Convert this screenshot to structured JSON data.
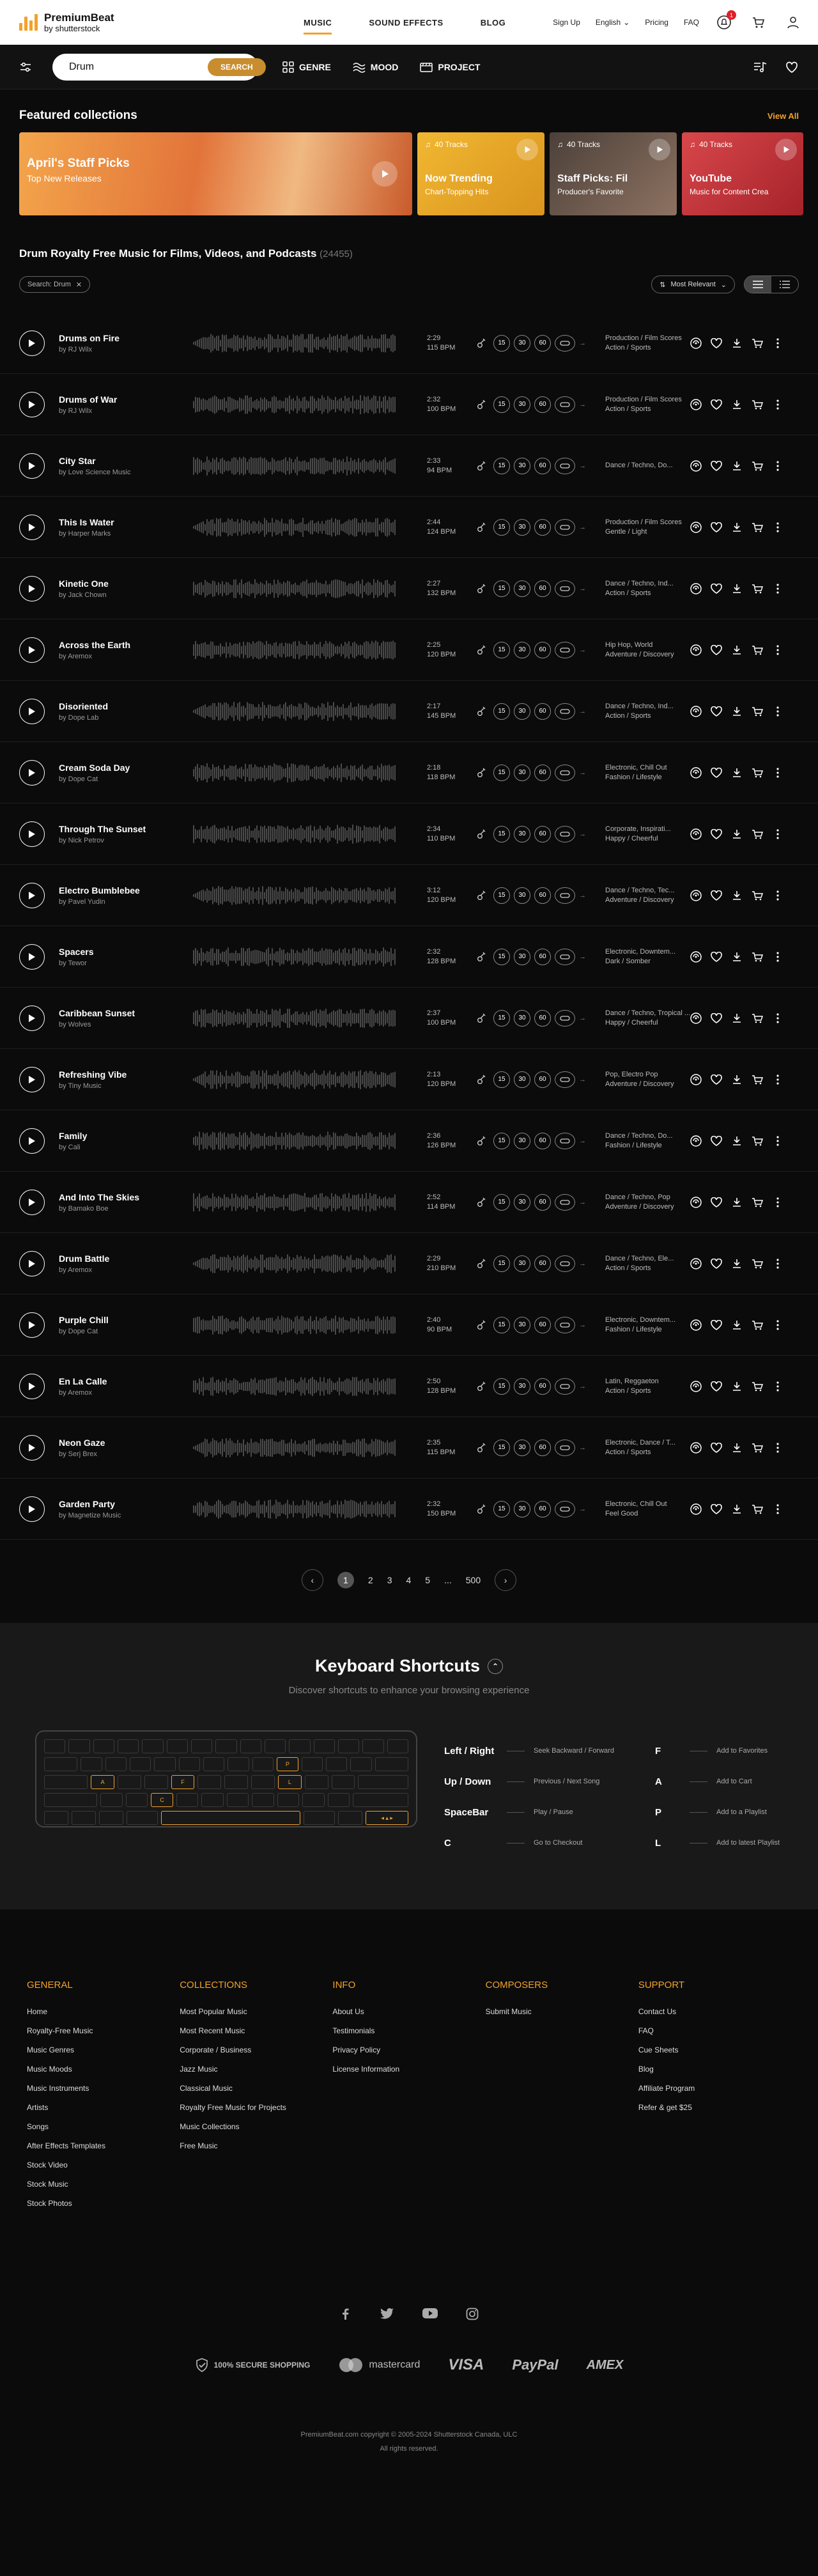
{
  "header": {
    "logo_line1": "PremiumBeat",
    "logo_line2": "by shutterstock",
    "nav": [
      "MUSIC",
      "SOUND EFFECTS",
      "BLOG"
    ],
    "signup": "Sign Up",
    "language": "English",
    "pricing": "Pricing",
    "faq": "FAQ",
    "notif_count": "1"
  },
  "filters": {
    "search_value": "Drum",
    "search_button": "SEARCH",
    "genre": "GENRE",
    "mood": "MOOD",
    "project": "PROJECT"
  },
  "featured": {
    "title": "Featured collections",
    "view_all": "View All",
    "cards": [
      {
        "title": "April's Staff Picks",
        "sub": "Top New Releases",
        "tracks": "",
        "color": "#e98a3a"
      },
      {
        "title": "Now Trending",
        "sub": "Chart-Topping Hits",
        "tracks": "40 Tracks",
        "color": "#e8a92c"
      },
      {
        "title": "Staff Picks: Fil",
        "sub": "Producer's Favorite",
        "tracks": "40 Tracks",
        "color": "#6b5a50"
      },
      {
        "title": "YouTube",
        "sub": "Music for Content Crea",
        "tracks": "40 Tracks",
        "color": "#c0363e"
      }
    ]
  },
  "results": {
    "heading": "Drum Royalty Free Music for Films, Videos, and Podcasts",
    "count": "(24455)",
    "chip": "Search: Drum",
    "sort": "Most Relevant"
  },
  "tracks": [
    {
      "title": "Drums on Fire",
      "artist": "by RJ Wilx",
      "dur": "2:29",
      "bpm": "115 BPM",
      "g1": "Production / Film Scores",
      "g2": "Action / Sports"
    },
    {
      "title": "Drums of War",
      "artist": "by RJ Wilx",
      "dur": "2:32",
      "bpm": "100 BPM",
      "g1": "Production / Film Scores",
      "g2": "Action / Sports"
    },
    {
      "title": "City Star",
      "artist": "by Love Science Music",
      "dur": "2:33",
      "bpm": "94 BPM",
      "g1": "Dance / Techno, Do...",
      "g2": ""
    },
    {
      "title": "This Is Water",
      "artist": "by Harper Marks",
      "dur": "2:44",
      "bpm": "124 BPM",
      "g1": "Production / Film Scores",
      "g2": "Gentle / Light"
    },
    {
      "title": "Kinetic One",
      "artist": "by Jack Chown",
      "dur": "2:27",
      "bpm": "132 BPM",
      "g1": "Dance / Techno, Ind...",
      "g2": "Action / Sports"
    },
    {
      "title": "Across the Earth",
      "artist": "by Aremox",
      "dur": "2:25",
      "bpm": "120 BPM",
      "g1": "Hip Hop, World",
      "g2": "Adventure / Discovery"
    },
    {
      "title": "Disoriented",
      "artist": "by Dope Lab",
      "dur": "2:17",
      "bpm": "145 BPM",
      "g1": "Dance / Techno, Ind...",
      "g2": "Action / Sports"
    },
    {
      "title": "Cream Soda Day",
      "artist": "by Dope Cat",
      "dur": "2:18",
      "bpm": "118 BPM",
      "g1": "Electronic, Chill Out",
      "g2": "Fashion / Lifestyle"
    },
    {
      "title": "Through The Sunset",
      "artist": "by Nick Petrov",
      "dur": "2:34",
      "bpm": "110 BPM",
      "g1": "Corporate, Inspirati...",
      "g2": "Happy / Cheerful"
    },
    {
      "title": "Electro Bumblebee",
      "artist": "by Pavel Yudin",
      "dur": "3:12",
      "bpm": "120 BPM",
      "g1": "Dance / Techno, Tec...",
      "g2": "Adventure / Discovery"
    },
    {
      "title": "Spacers",
      "artist": "by Tewor",
      "dur": "2:32",
      "bpm": "128 BPM",
      "g1": "Electronic, Downtem...",
      "g2": "Dark / Somber"
    },
    {
      "title": "Caribbean Sunset",
      "artist": "by Wolves",
      "dur": "2:37",
      "bpm": "100 BPM",
      "g1": "Dance / Techno, Tropical ...",
      "g2": "Happy / Cheerful"
    },
    {
      "title": "Refreshing Vibe",
      "artist": "by Tiny Music",
      "dur": "2:13",
      "bpm": "120 BPM",
      "g1": "Pop, Electro Pop",
      "g2": "Adventure / Discovery"
    },
    {
      "title": "Family",
      "artist": "by Cali",
      "dur": "2:36",
      "bpm": "126 BPM",
      "g1": "Dance / Techno, Do...",
      "g2": "Fashion / Lifestyle"
    },
    {
      "title": "And Into The Skies",
      "artist": "by Bamako Boe",
      "dur": "2:52",
      "bpm": "114 BPM",
      "g1": "Dance / Techno, Pop",
      "g2": "Adventure / Discovery"
    },
    {
      "title": "Drum Battle",
      "artist": "by Aremox",
      "dur": "2:29",
      "bpm": "210 BPM",
      "g1": "Dance / Techno, Ele...",
      "g2": "Action / Sports"
    },
    {
      "title": "Purple Chill",
      "artist": "by Dope Cat",
      "dur": "2:40",
      "bpm": "90 BPM",
      "g1": "Electronic, Downtem...",
      "g2": "Fashion / Lifestyle"
    },
    {
      "title": "En La Calle",
      "artist": "by Aremox",
      "dur": "2:50",
      "bpm": "128 BPM",
      "g1": "Latin, Reggaeton",
      "g2": "Action / Sports"
    },
    {
      "title": "Neon Gaze",
      "artist": "by Serj Brex",
      "dur": "2:35",
      "bpm": "115 BPM",
      "g1": "Electronic, Dance / T...",
      "g2": "Action / Sports"
    },
    {
      "title": "Garden Party",
      "artist": "by Magnetize Music",
      "dur": "2:32",
      "bpm": "150 BPM",
      "g1": "Electronic, Chill Out",
      "g2": "Feel Good"
    }
  ],
  "edit_lengths": [
    "15",
    "30",
    "60"
  ],
  "pagination": {
    "pages": [
      "1",
      "2",
      "3",
      "4",
      "5"
    ],
    "ellipsis": "...",
    "last": "500",
    "current": "1"
  },
  "keyboard": {
    "title": "Keyboard Shortcuts",
    "subtitle": "Discover shortcuts to enhance your browsing experience",
    "shortcuts_left": [
      {
        "key": "Left / Right",
        "desc": "Seek Backward / Forward"
      },
      {
        "key": "Up / Down",
        "desc": "Previous / Next Song"
      },
      {
        "key": "SpaceBar",
        "desc": "Play / Pause"
      },
      {
        "key": "C",
        "desc": "Go to Checkout"
      }
    ],
    "shortcuts_right": [
      {
        "key": "F",
        "desc": "Add to Favorites"
      },
      {
        "key": "A",
        "desc": "Add to Cart"
      },
      {
        "key": "P",
        "desc": "Add to a Playlist"
      },
      {
        "key": "L",
        "desc": "Add to latest Playlist"
      }
    ]
  },
  "footer": {
    "columns": [
      {
        "title": "GENERAL",
        "links": [
          "Home",
          "Royalty-Free Music",
          "Music Genres",
          "Music Moods",
          "Music Instruments",
          "Artists",
          "Songs",
          "After Effects Templates",
          "Stock Video",
          "Stock Music",
          "Stock Photos"
        ]
      },
      {
        "title": "COLLECTIONS",
        "links": [
          "Most Popular Music",
          "Most Recent Music",
          "Corporate / Business",
          "Jazz Music",
          "Classical Music",
          "Royalty Free Music for Projects",
          "Music Collections",
          "Free Music"
        ]
      },
      {
        "title": "INFO",
        "links": [
          "About Us",
          "Testimonials",
          "Privacy Policy",
          "License Information"
        ]
      },
      {
        "title": "COMPOSERS",
        "links": [
          "Submit Music"
        ]
      },
      {
        "title": "SUPPORT",
        "links": [
          "Contact Us",
          "FAQ",
          "Cue Sheets",
          "Blog",
          "Affiliate Program",
          "Refer & get $25"
        ]
      }
    ],
    "secure": "100% SECURE SHOPPING",
    "payments": [
      "mastercard",
      "VISA",
      "PayPal",
      "AMEX"
    ],
    "copyright": "PremiumBeat.com copyright © 2005-2024 Shutterstock Canada, ULC",
    "rights": "All rights reserved."
  }
}
